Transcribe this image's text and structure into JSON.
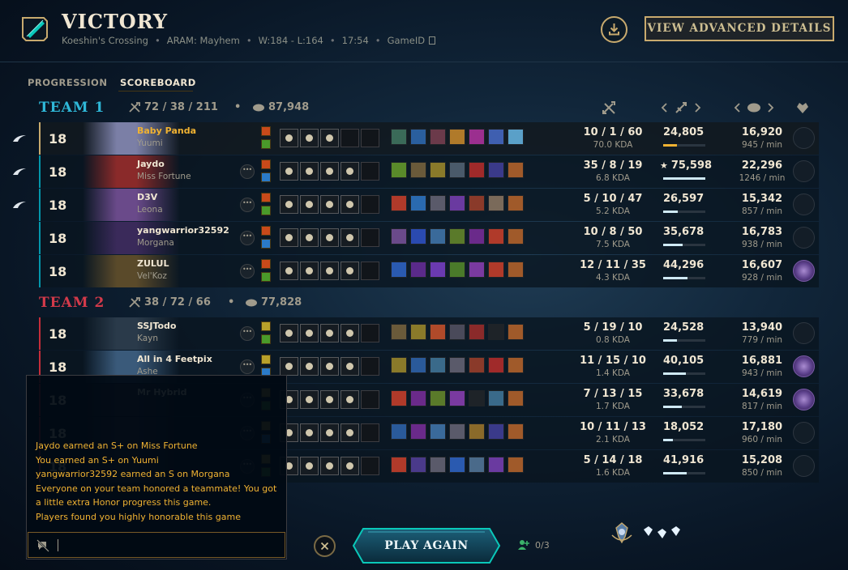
{
  "header": {
    "title": "VICTORY",
    "map": "Koeshin's Crossing",
    "mode": "ARAM: Mayhem",
    "record": "W:184 - L:164",
    "duration": "17:54",
    "game_id_label": "GameID",
    "advanced_button": "VIEW ADVANCED DETAILS"
  },
  "tabs": [
    {
      "label": "PROGRESSION",
      "active": false
    },
    {
      "label": "SCOREBOARD",
      "active": true
    }
  ],
  "teams": [
    {
      "name": "TEAM 1",
      "color": "#2fb8d8",
      "kda": "72 / 38 / 211",
      "gold": "87,948",
      "players": [
        {
          "level": "18",
          "name": "Baby Panda",
          "champion": "Yuumi",
          "kda": "10 / 1 / 60",
          "kda_ratio": "70.0 KDA",
          "damage": "24,805",
          "damage_share": 0.33,
          "gold": "16,920",
          "gold_per_min": "945 / min",
          "me": true,
          "party": true,
          "honored": false,
          "star": false,
          "colors": {
            "portrait": "#7b7fa6",
            "items": [
              "#3a6a58",
              "#2a5f9e",
              "#6b3a4a",
              "#b07a2a",
              "#9b2f8f",
              "#3f5fb0",
              "#5aa0c8"
            ]
          }
        },
        {
          "level": "18",
          "name": "Jaydo",
          "champion": "Miss Fortune",
          "kda": "35 / 8 / 19",
          "kda_ratio": "6.8 KDA",
          "damage": "75,598",
          "damage_share": 1.0,
          "gold": "22,296",
          "gold_per_min": "1246 / min",
          "me": false,
          "party": true,
          "honored": false,
          "star": true,
          "colors": {
            "portrait": "#8a2a2a",
            "items": [
              "#5a8a2a",
              "#6a5a3a",
              "#8a7a2a",
              "#4a5a6a",
              "#a02a2a",
              "#3a3a8a",
              "#a05a2a"
            ]
          }
        },
        {
          "level": "18",
          "name": "D3V",
          "champion": "Leona",
          "kda": "5 / 10 / 47",
          "kda_ratio": "5.2 KDA",
          "damage": "26,597",
          "damage_share": 0.35,
          "gold": "15,342",
          "gold_per_min": "857 / min",
          "me": false,
          "party": true,
          "honored": false,
          "star": false,
          "colors": {
            "portrait": "#6a4a8a",
            "items": [
              "#b03a2a",
              "#2a6ab0",
              "#5a5a6a",
              "#6a3aa0",
              "#8a3a2a",
              "#7a6a5a",
              "#a05a2a"
            ]
          }
        },
        {
          "level": "18",
          "name": "yangwarrior32592",
          "champion": "Morgana",
          "kda": "10 / 8 / 50",
          "kda_ratio": "7.5 KDA",
          "damage": "35,678",
          "damage_share": 0.47,
          "gold": "16,783",
          "gold_per_min": "938 / min",
          "me": false,
          "party": false,
          "honored": false,
          "star": false,
          "colors": {
            "portrait": "#3a2a5a",
            "items": [
              "#6a4a8a",
              "#2a4ab0",
              "#3a6a9a",
              "#5a7a2a",
              "#6a2a8a",
              "#b03a2a",
              "#a05a2a"
            ]
          }
        },
        {
          "level": "18",
          "name": "ZULUL",
          "champion": "Vel'Koz",
          "kda": "12 / 11 / 35",
          "kda_ratio": "4.3 KDA",
          "damage": "44,296",
          "damage_share": 0.58,
          "gold": "16,607",
          "gold_per_min": "928 / min",
          "me": false,
          "party": false,
          "honored": true,
          "star": false,
          "colors": {
            "portrait": "#5a4a2a",
            "items": [
              "#2a5ab0",
              "#5a2a8a",
              "#6a3ab0",
              "#4a7a2a",
              "#7a3aa0",
              "#b03a2a",
              "#a05a2a"
            ]
          }
        }
      ]
    },
    {
      "name": "TEAM 2",
      "color": "#d33a4a",
      "kda": "38 / 72 / 66",
      "gold": "77,828",
      "players": [
        {
          "level": "18",
          "name": "SSJTodo",
          "champion": "Kayn",
          "kda": "5 / 19 / 10",
          "kda_ratio": "0.8 KDA",
          "damage": "24,528",
          "damage_share": 0.32,
          "gold": "13,940",
          "gold_per_min": "779 / min",
          "me": false,
          "party": false,
          "honored": false,
          "star": false,
          "colors": {
            "portrait": "#2a3a4a",
            "items": [
              "#6a5a3a",
              "#8a7a2a",
              "#b04a2a",
              "#4a4a5a",
              "#8a2a2a",
              "#1e2328",
              "#a05a2a"
            ]
          }
        },
        {
          "level": "18",
          "name": "All in 4 Feetpix",
          "champion": "Ashe",
          "kda": "11 / 15 / 10",
          "kda_ratio": "1.4 KDA",
          "damage": "40,105",
          "damage_share": 0.53,
          "gold": "16,881",
          "gold_per_min": "943 / min",
          "me": false,
          "party": false,
          "honored": true,
          "star": false,
          "colors": {
            "portrait": "#3a5a7a",
            "items": [
              "#8a7a2a",
              "#2a5a9a",
              "#3a6a8a",
              "#5a5a6a",
              "#8a3a2a",
              "#a02a2a",
              "#a05a2a"
            ]
          }
        },
        {
          "level": "18",
          "name": "Mr Hybrid",
          "champion": "",
          "kda": "7 / 13 / 15",
          "kda_ratio": "1.7 KDA",
          "damage": "33,678",
          "damage_share": 0.45,
          "gold": "14,619",
          "gold_per_min": "817 / min",
          "me": false,
          "party": false,
          "honored": true,
          "star": false,
          "colors": {
            "portrait": "#2a2a3a",
            "items": [
              "#b03a2a",
              "#6a2a8a",
              "#5a7a2a",
              "#7a3aa0",
              "#1e2328",
              "#3a6a8a",
              "#a05a2a"
            ]
          }
        },
        {
          "level": "18",
          "name": "",
          "champion": "",
          "kda": "10 / 11 / 13",
          "kda_ratio": "2.1 KDA",
          "damage": "18,052",
          "damage_share": 0.24,
          "gold": "17,180",
          "gold_per_min": "960 / min",
          "me": false,
          "party": false,
          "honored": false,
          "star": false,
          "colors": {
            "portrait": "#2a2a3a",
            "items": [
              "#2a5a9a",
              "#6a2a8a",
              "#3a6a9a",
              "#5a5a6a",
              "#8a6a2a",
              "#3a3a8a",
              "#a05a2a"
            ]
          }
        },
        {
          "level": "18",
          "name": "",
          "champion": "",
          "kda": "5 / 14 / 18",
          "kda_ratio": "1.6 KDA",
          "damage": "41,916",
          "damage_share": 0.55,
          "gold": "15,208",
          "gold_per_min": "850 / min",
          "me": false,
          "party": false,
          "honored": false,
          "star": false,
          "colors": {
            "portrait": "#2a2a3a",
            "items": [
              "#b03a2a",
              "#4a3a8a",
              "#5a5a6a",
              "#2a5ab0",
              "#4a6a8a",
              "#6a3aa0",
              "#a05a2a"
            ]
          }
        }
      ]
    }
  ],
  "chat": {
    "messages": [
      "Jaydo earned an S+ on Miss Fortune",
      "You earned an S+ on Yuumi",
      "yangwarrior32592 earned an S on Morgana",
      "Everyone on your team honored a teammate! You got a little extra Honor progress this game.",
      "Players found you highly honorable this game"
    ],
    "input_value": ""
  },
  "footer": {
    "play_again": "PLAY AGAIN",
    "lobby_count": "0/3"
  },
  "colors": {
    "gold": "#c8aa6e",
    "team1": "#2fb8d8",
    "team2": "#d33a4a",
    "highlight_name": "#f0b232",
    "bar": "#cfe9f5"
  }
}
